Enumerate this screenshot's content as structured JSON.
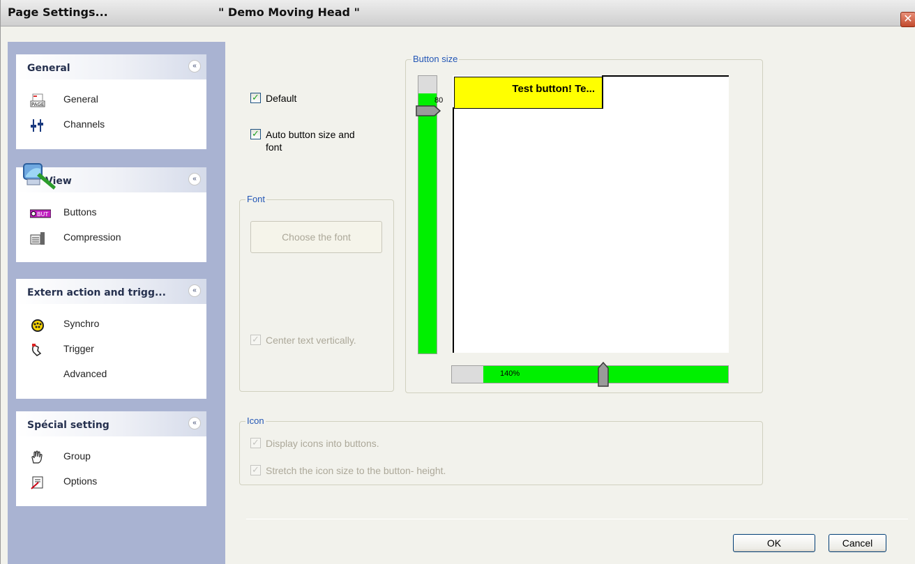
{
  "window": {
    "title": "Page  Settings...",
    "document": "\" Demo Moving Head \"",
    "close_glyph": "✕"
  },
  "sidebar": {
    "collapse_glyph": "«",
    "panels": [
      {
        "title": "General",
        "items": [
          {
            "label": "General",
            "icon": "page-icon"
          },
          {
            "label": "Channels",
            "icon": "sliders-icon"
          }
        ]
      },
      {
        "title": "View",
        "items": [
          {
            "label": "Buttons",
            "icon": "button-icon"
          },
          {
            "label": "Compression",
            "icon": "compress-icon"
          }
        ]
      },
      {
        "title": "Extern action and trigg...",
        "items": [
          {
            "label": "Synchro",
            "icon": "dmx-connector-icon"
          },
          {
            "label": "Trigger",
            "icon": "hand-trigger-icon"
          },
          {
            "label": "Advanced",
            "icon": ""
          }
        ]
      },
      {
        "title": "Spécial setting",
        "items": [
          {
            "label": "Group",
            "icon": "hand-icon"
          },
          {
            "label": "Options",
            "icon": "options-icon"
          }
        ]
      }
    ]
  },
  "options": {
    "default": {
      "label": "Default",
      "checked": true
    },
    "auto_size": {
      "label_line1": "Auto button size and",
      "label_line2": "font",
      "checked": true
    }
  },
  "font_group": {
    "legend": "Font",
    "choose_button": "Choose the font",
    "center_vertical": {
      "label": "Center text vertically.",
      "checked": true,
      "enabled": false
    }
  },
  "button_size": {
    "legend": "Button size",
    "vertical_value": "80",
    "horizontal_label": "140%",
    "test_button_text": "Test button! Te..."
  },
  "icon_group": {
    "legend": "Icon",
    "display_icons": {
      "label": "Display icons into buttons.",
      "checked": true,
      "enabled": false
    },
    "stretch_icons": {
      "label": "Stretch the icon size to the button- height.",
      "checked": true,
      "enabled": false
    }
  },
  "footer": {
    "ok": "OK",
    "cancel": "Cancel"
  },
  "colors": {
    "slider_fill": "#00f000",
    "test_button": "#ffff00",
    "sidebar": "#a9b3d2",
    "legend": "#2356b5"
  }
}
